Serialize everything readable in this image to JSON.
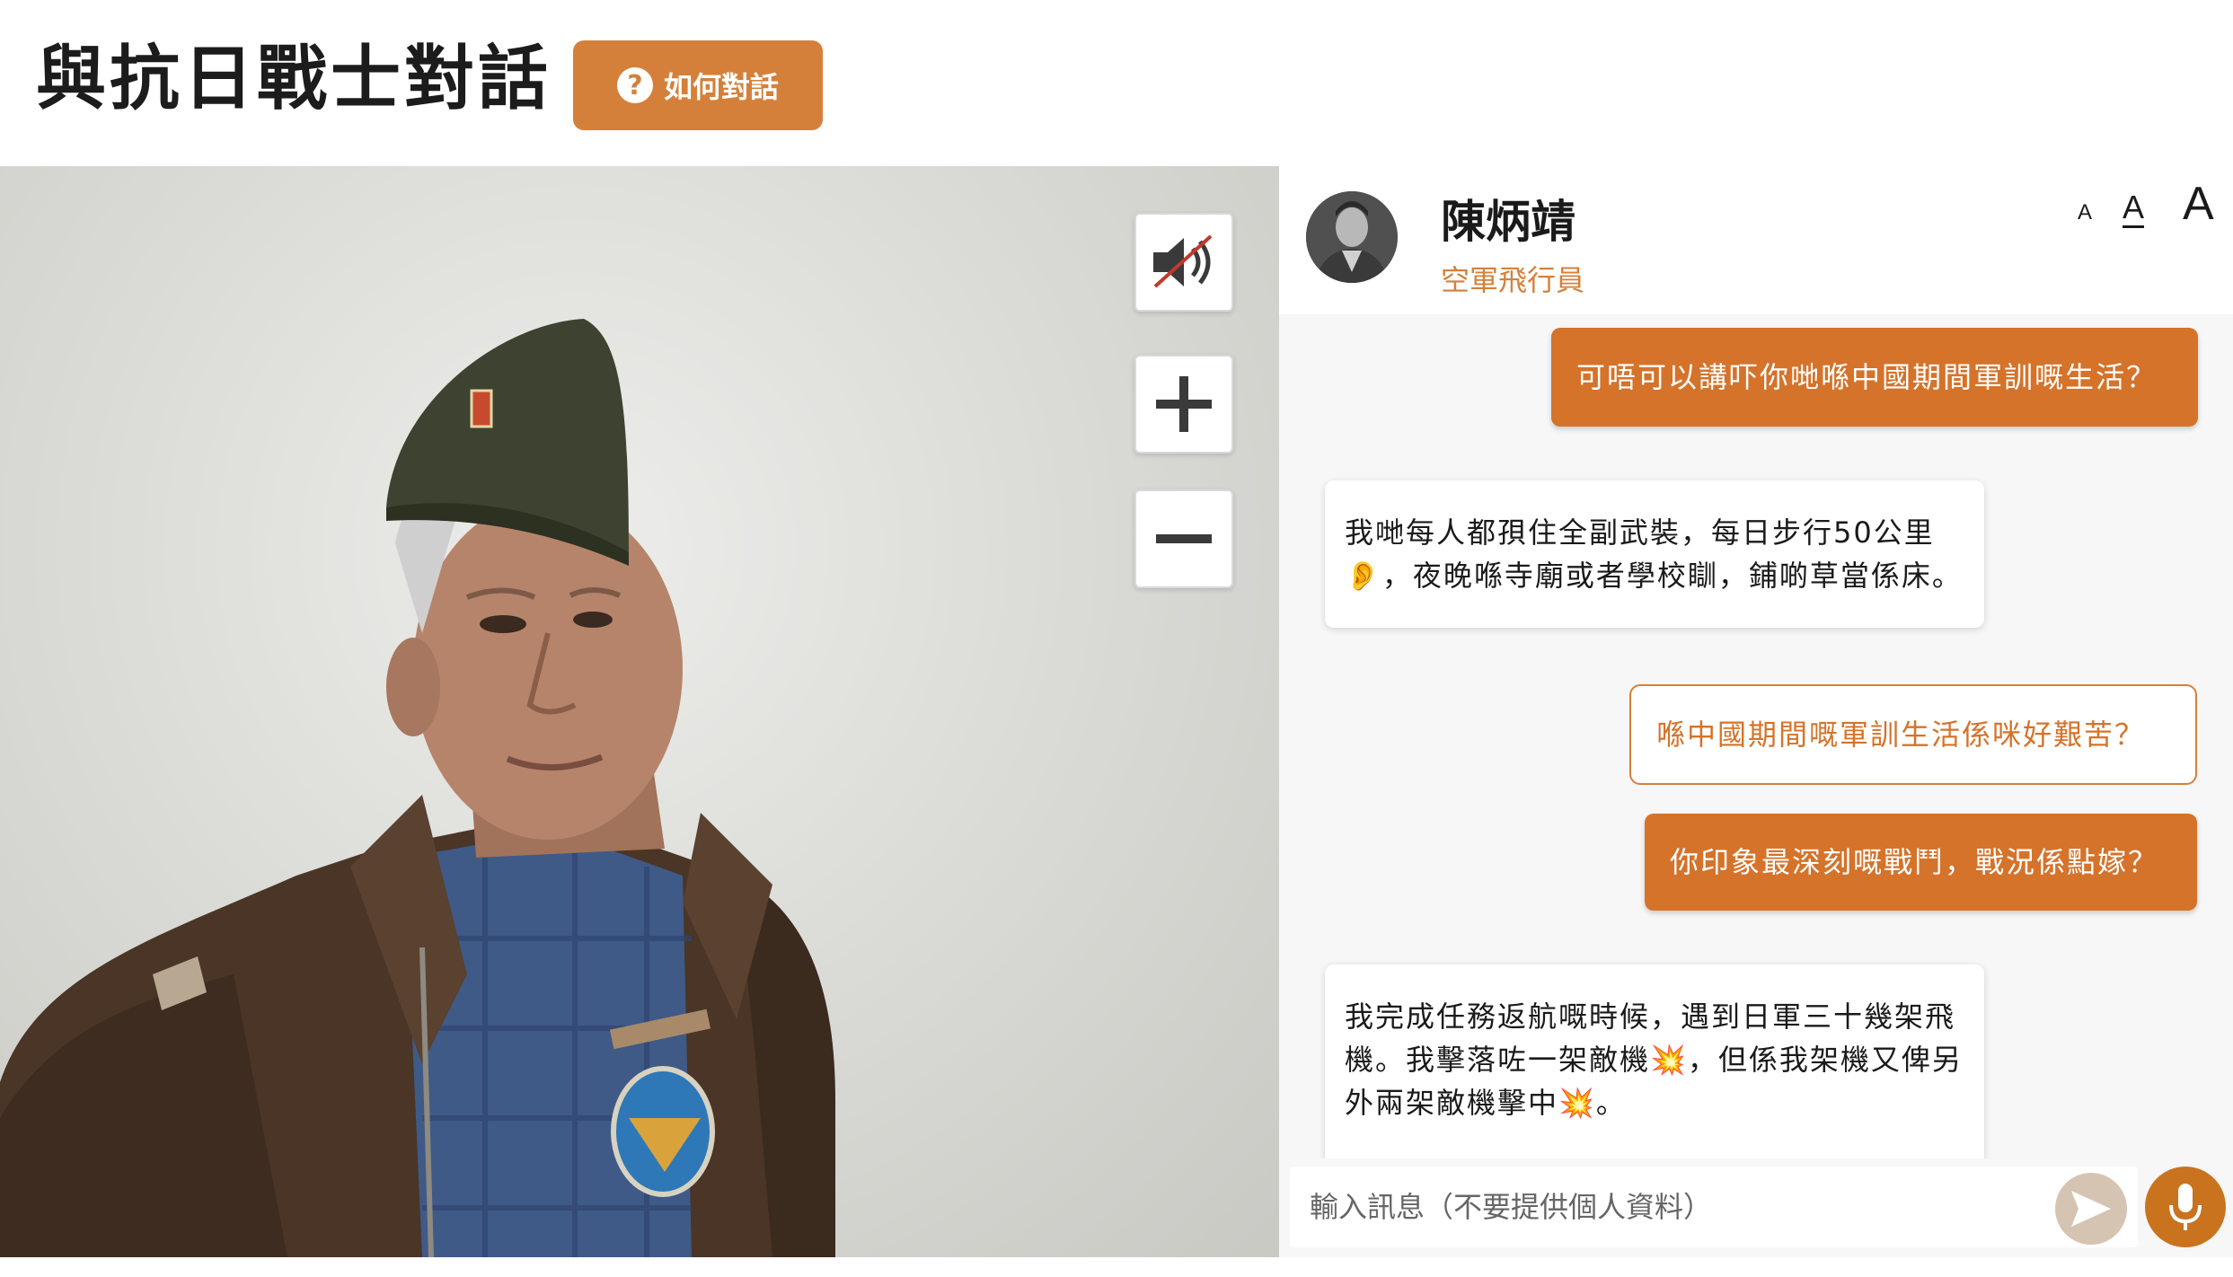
{
  "header": {
    "title": "與抗日戰士對話",
    "help_button": {
      "icon": "question-circle-icon",
      "label": "如何對話"
    }
  },
  "scene": {
    "controls": [
      {
        "name": "mute-toggle",
        "icon": "speaker-muted-icon"
      },
      {
        "name": "zoom-in",
        "icon": "plus-icon"
      },
      {
        "name": "zoom-out",
        "icon": "minus-icon"
      }
    ]
  },
  "chat": {
    "profile": {
      "name": "陳炳靖",
      "role": "空軍飛行員"
    },
    "font_sizes": [
      "A",
      "A",
      "A"
    ],
    "messages": [
      {
        "type": "user",
        "text": "可唔可以講吓你哋喺中國期間軍訓嘅生活？"
      },
      {
        "type": "bot",
        "lines": [
          "我哋每人都孭住全副武裝，每日步行50公里",
          "👂，夜晚喺寺廟或者學校瞓，鋪啲草當係床。"
        ]
      },
      {
        "type": "suggestion",
        "text": "喺中國期間嘅軍訓生活係咪好艱苦？"
      },
      {
        "type": "user",
        "text": "你印象最深刻嘅戰鬥，戰況係點嫁？"
      },
      {
        "type": "bot",
        "lines": [
          "我完成任務返航嘅時候，遇到日軍三十幾架飛",
          "機。我擊落咗一架敵機💥，但係我架機又俾另",
          "外兩架敵機擊中💥。"
        ]
      }
    ],
    "input": {
      "placeholder": "輸入訊息（不要提供個人資料）",
      "value": ""
    },
    "send_icon": "send-arrow-icon",
    "mic_icon": "microphone-icon"
  },
  "colors": {
    "accent": "#d5803a",
    "user_bubble": "#d5732a",
    "send_disabled": "#d6c4b2"
  }
}
